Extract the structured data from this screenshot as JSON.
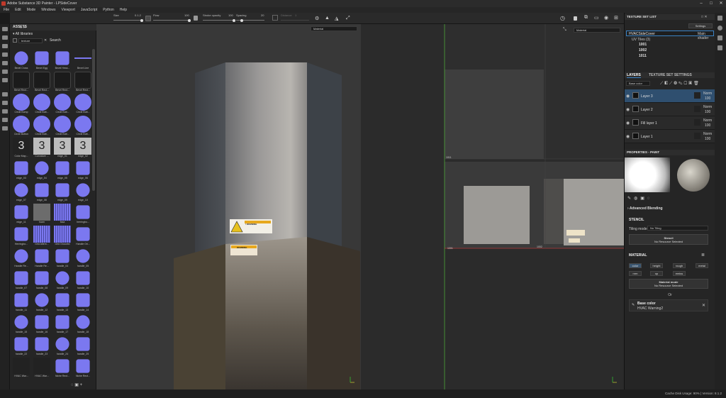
{
  "window": {
    "title": "Adobe Substance 3D Painter - LPSideCover",
    "minimize": "–",
    "maximize": "□",
    "close": "✕"
  },
  "menu": [
    "File",
    "Edit",
    "Mode",
    "Windows",
    "Viewport",
    "JavaScript",
    "Python",
    "Help"
  ],
  "toolbar": {
    "size_label": "Size",
    "size_value": "0.1.2",
    "flow_label": "Flow",
    "flow_value": "100",
    "stroke_label": "Stroke opacity",
    "stroke_value": "100",
    "spacing_label": "Spacing",
    "spacing_value": "20",
    "distance_label": "Distance",
    "distance_value": "1"
  },
  "assets": {
    "title": "ASSETS",
    "library": "All libraries",
    "filter_value": "texture",
    "search_label": "Search",
    "items": [
      "Bevel Cross",
      "Bevel Egg",
      "Bevel Hexa...",
      "Bevel Line",
      "Bevel Rect...",
      "Bevel Rect...",
      "Bevel Rect...",
      "Bevel Rect...",
      "Circle Bump",
      "Circle Butt...",
      "Circle Butt...",
      "Circle Butt...",
      "Circle Button",
      "Circle Butt...",
      "Circle Butt...",
      "Circle Butt...",
      "Color Map...",
      "Curvature ...",
      "edge_01",
      "edge_02",
      "edge_03",
      "edge_04",
      "edge_05",
      "edge_06",
      "edge_07",
      "edge_08",
      "edge_09",
      "edge_10",
      "edge_11",
      "foam",
      "fxaa",
      "herringbo...",
      "Herringbo...",
      "Grid Altern...",
      "Grid Grooved",
      "Handle Ori...",
      "Handle Re...",
      "Handle Re...",
      "handle_04",
      "handle_05",
      "handle_07",
      "handle_08",
      "handle_09",
      "handle_10",
      "handle_11",
      "handle_12",
      "handle_13",
      "handle_14",
      "handle_15",
      "handle_16",
      "handle_17",
      "handle_18",
      "handle_22",
      "handle_23",
      "handle_24",
      "handle_25",
      "HVAC War...",
      "HVAC War...",
      "Niche Rect...",
      "Niche Rect..."
    ]
  },
  "viewport3d": {
    "material_select": "Material",
    "warning_top": "! WARNING",
    "warning_bottom": "WARNING"
  },
  "viewport2d": {
    "material_select": "Material",
    "uv_1001": "1001",
    "uv_1002": "1002",
    "uv_1003": "1003"
  },
  "texture_set_list": {
    "title": "TEXTURE SET LIST",
    "settings": "Settings",
    "set_name": "HVACSideCover",
    "shader": "Main shader",
    "uv_tiles": "UV Tiles (3)",
    "tiles": [
      "1001",
      "1002",
      "1011"
    ]
  },
  "layers": {
    "tab_layers": "LAYERS",
    "tab_tss": "TEXTURE SET SETTINGS",
    "channel": "Base color",
    "rows": [
      {
        "name": "Layer 3",
        "blend": "Norm",
        "opacity": "100"
      },
      {
        "name": "Layer 2",
        "blend": "Norm",
        "opacity": "100"
      },
      {
        "name": "Fill layer 1",
        "blend": "Norm",
        "opacity": "100"
      },
      {
        "name": "Layer 1",
        "blend": "Norm",
        "opacity": "100"
      }
    ]
  },
  "properties": {
    "title": "PROPERTIES - PAINT",
    "advanced_blending": "Advanced Blending",
    "stencil_header": "STENCIL",
    "tiling_label": "Tiling mode",
    "tiling_value": "No Tiling",
    "stencil_btn": "Stencil",
    "stencil_sub": "No Resource Selected",
    "material_header": "MATERIAL",
    "channels": [
      "color",
      "height",
      "rough",
      "metal",
      "nrm",
      "op",
      "emiss"
    ],
    "material_mode": "Material mode",
    "material_mode_sub": "No Resource Selected",
    "or": "Or",
    "base_color": "Base color",
    "base_color_value": "HVAC Warning2"
  },
  "status": "Cache Disk Usage: 90% | Version: 8.1.2",
  "colors": {
    "accent": "#3b82c4",
    "blue_thumb": "#7b78f0",
    "selected": "#2f4f6f"
  }
}
